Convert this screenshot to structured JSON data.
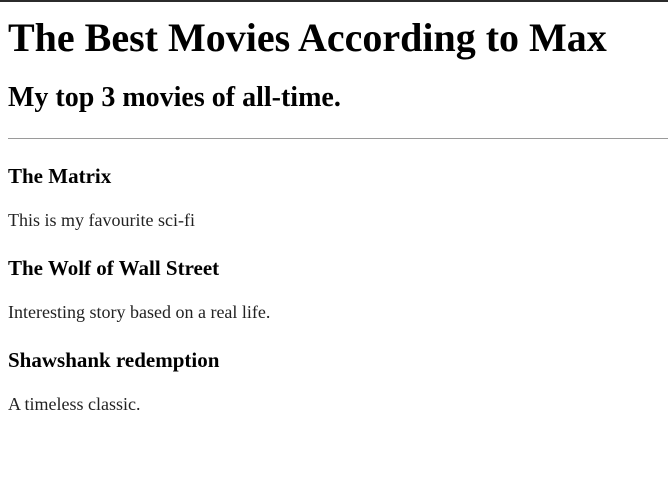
{
  "page": {
    "title": "The Best Movies According to Max",
    "subtitle": "My top 3 movies of all-time."
  },
  "movies": [
    {
      "title": "The Matrix",
      "description": "This is my favourite sci-fi"
    },
    {
      "title": "The Wolf of Wall Street",
      "description": "Interesting story based on a real life."
    },
    {
      "title": "Shawshank redemption",
      "description": "A timeless classic."
    }
  ]
}
